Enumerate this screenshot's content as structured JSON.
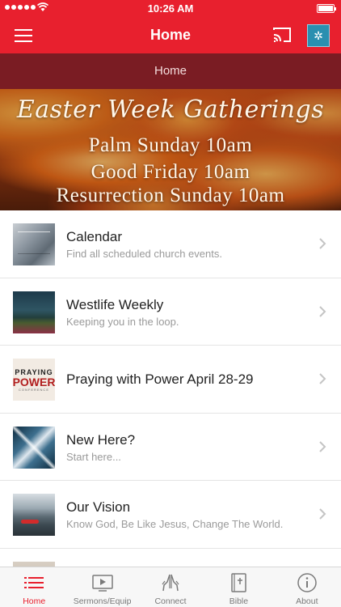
{
  "status_bar": {
    "time": "10:26 AM"
  },
  "nav": {
    "title": "Home"
  },
  "subheader": {
    "title": "Home"
  },
  "banner": {
    "title": "Easter Week Gatherings",
    "lines": [
      "Palm Sunday 10am",
      "Good Friday 10am",
      "Resurrection Sunday 10am"
    ]
  },
  "list": {
    "items": [
      {
        "title": "Calendar",
        "subtitle": "Find all scheduled church events."
      },
      {
        "title": "Westlife Weekly",
        "subtitle": "Keeping you in the loop."
      },
      {
        "title": "Praying with Power April 28-29",
        "subtitle": ""
      },
      {
        "title": "New Here?",
        "subtitle": "Start here..."
      },
      {
        "title": "Our Vision",
        "subtitle": "Know God, Be Like Jesus, Change The World."
      }
    ]
  },
  "thumbnails": {
    "praying_power": {
      "line1": "PRAYING",
      "line2": "POWER",
      "line3": "CONFERENCE"
    }
  },
  "tab_bar": {
    "active": "Home",
    "accent_color": "#e8202e",
    "tabs": [
      {
        "label": "Home",
        "icon": "list-icon"
      },
      {
        "label": "Sermons/Equip",
        "icon": "video-icon"
      },
      {
        "label": "Connect",
        "icon": "praying-hands-icon"
      },
      {
        "label": "Bible",
        "icon": "bible-icon"
      },
      {
        "label": "About",
        "icon": "info-icon"
      }
    ]
  },
  "colors": {
    "primary": "#e8202e",
    "subheader": "#7a1c23"
  }
}
